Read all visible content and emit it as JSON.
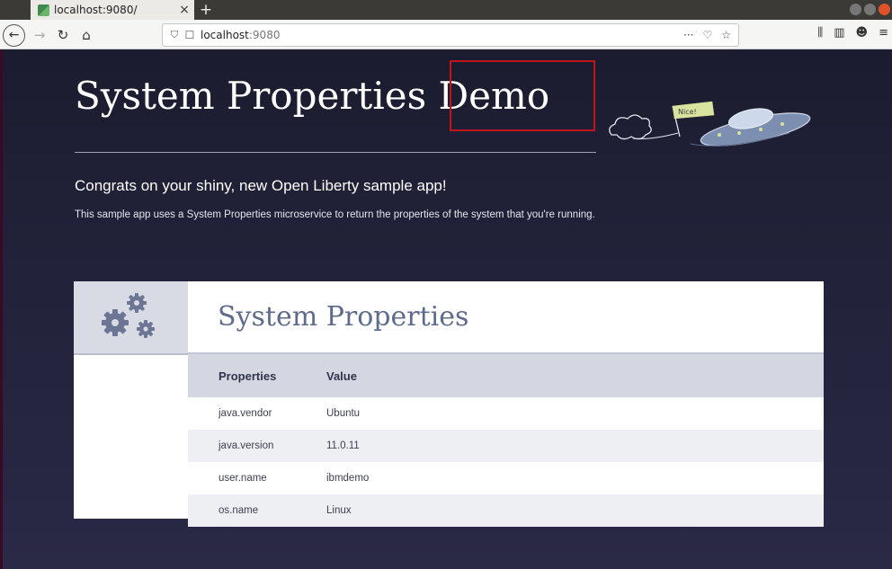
{
  "browser": {
    "tab_title": "localhost:9080/",
    "tab_close": "×",
    "new_tab": "+",
    "url_host": "localhost",
    "url_port": ":9080",
    "url_actions": [
      "···",
      "♡",
      "☆"
    ]
  },
  "page": {
    "title": "System Properties Demo",
    "subtitle": "Congrats on your shiny, new Open Liberty sample app!",
    "description": "This sample app uses a System Properties microservice to return the properties of the system that you're running.",
    "ufo_flag_text": "Nice!"
  },
  "card": {
    "title": "System Properties",
    "columns": [
      "Properties",
      "Value"
    ],
    "rows": [
      {
        "property": "java.vendor",
        "value": "Ubuntu"
      },
      {
        "property": "java.version",
        "value": "11.0.11"
      },
      {
        "property": "user.name",
        "value": "ibmdemo"
      },
      {
        "property": "os.name",
        "value": "Linux"
      }
    ]
  },
  "colors": {
    "background": "#1f1f33",
    "highlight_box": "#c0151a",
    "card_title": "#5e6b8c",
    "table_header": "#d4d7e2"
  },
  "icons": [
    "back-icon",
    "forward-icon",
    "reload-icon",
    "home-icon",
    "shield-icon",
    "page-icon",
    "library-icon",
    "sidebar-icon",
    "account-icon",
    "menu-icon",
    "gears-icon",
    "ufo-illustration"
  ]
}
